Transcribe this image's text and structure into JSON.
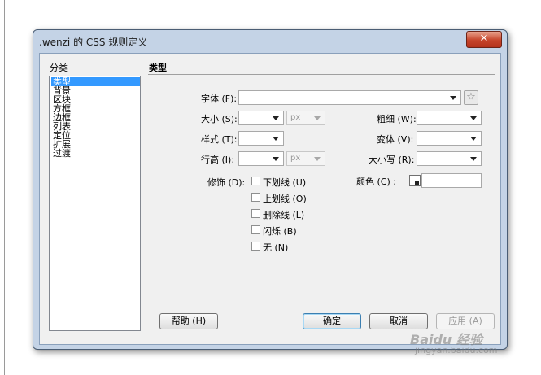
{
  "window": {
    "title": ".wenzi 的 CSS 规则定义",
    "close_glyph": "✕"
  },
  "category": {
    "label": "分类",
    "items": [
      "类型",
      "背景",
      "区块",
      "方框",
      "边框",
      "列表",
      "定位",
      "扩展",
      "过渡"
    ],
    "selected": "类型"
  },
  "section": {
    "title": "类型"
  },
  "fields": {
    "font_family": {
      "label": "字体 (F):",
      "value": ""
    },
    "font_size": {
      "label": "大小 (S):",
      "value": "",
      "unit": "px"
    },
    "font_weight": {
      "label": "粗细 (W):",
      "value": ""
    },
    "font_style": {
      "label": "样式 (T):",
      "value": ""
    },
    "font_variant": {
      "label": "变体 (V):",
      "value": ""
    },
    "line_height": {
      "label": "行高 (I):",
      "value": "",
      "unit": "px"
    },
    "text_transform": {
      "label": "大小写 (R):",
      "value": ""
    },
    "color": {
      "label": "颜色 (C) :",
      "value": ""
    }
  },
  "decoration": {
    "label": "修饰 (D):",
    "options": [
      {
        "label": "下划线 (U)",
        "checked": false
      },
      {
        "label": "上划线 (O)",
        "checked": false
      },
      {
        "label": "删除线 (L)",
        "checked": false
      },
      {
        "label": "闪烁 (B)",
        "checked": false
      },
      {
        "label": "无 (N)",
        "checked": false
      }
    ]
  },
  "buttons": {
    "help": "帮助 (H)",
    "ok": "确定",
    "cancel": "取消",
    "apply": "应用 (A)"
  },
  "watermark": {
    "brand": "Baidu 经验",
    "url": "jingyan.baidu.com"
  },
  "colors": {
    "selection": "#3399ff",
    "dialog_frame": "#c4d3e6",
    "client_bg": "#f0f0f0"
  }
}
